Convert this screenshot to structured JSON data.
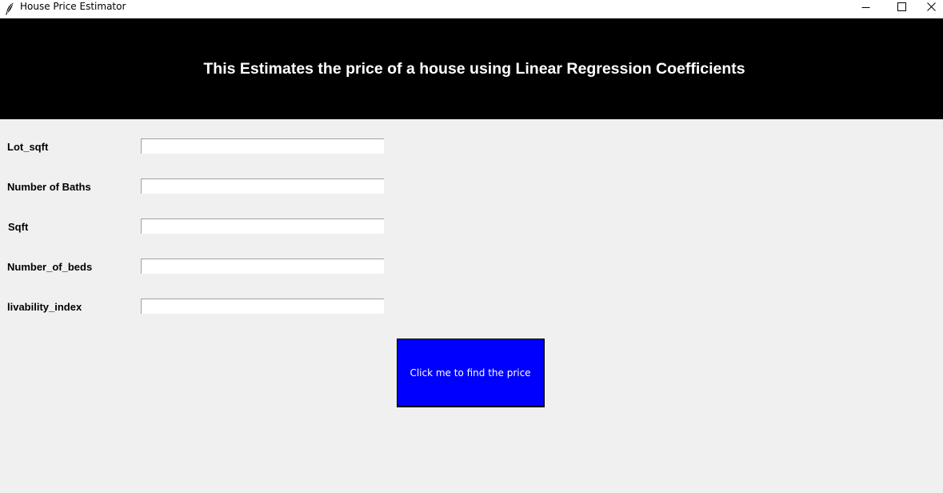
{
  "window": {
    "title": "House Price Estimator",
    "icon": "feather-icon",
    "controls": {
      "minimize_icon": "minimize-icon",
      "maximize_icon": "maximize-icon",
      "close_icon": "close-icon"
    }
  },
  "banner": {
    "title": "This Estimates the price of a house using Linear Regression Coefficients",
    "background": "#000000",
    "text_color": "#ffffff"
  },
  "form": {
    "fields": [
      {
        "label": "Lot_sqft",
        "value": ""
      },
      {
        "label": "Number of Baths",
        "value": ""
      },
      {
        "label": "Sqft",
        "value": ""
      },
      {
        "label": "Number_of_beds",
        "value": ""
      },
      {
        "label": "livability_index",
        "value": ""
      }
    ]
  },
  "action": {
    "button_label": "Click me to find the price",
    "button_color": "#0000ff",
    "button_text_color": "#ffffff"
  }
}
